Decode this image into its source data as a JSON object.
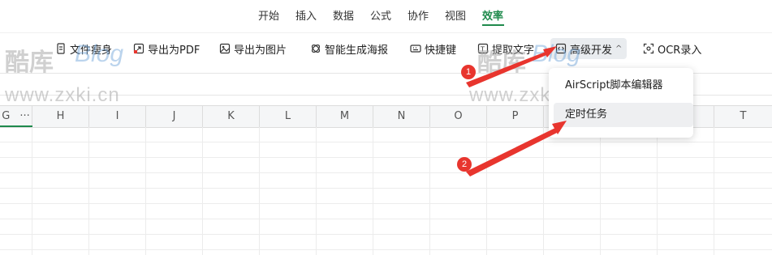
{
  "menu": {
    "items": [
      {
        "label": "开始"
      },
      {
        "label": "插入"
      },
      {
        "label": "数据"
      },
      {
        "label": "公式"
      },
      {
        "label": "协作"
      },
      {
        "label": "视图"
      },
      {
        "label": "效率",
        "active": true
      }
    ]
  },
  "toolbar": {
    "slim_file": "文件瘦身",
    "export_pdf": "导出为PDF",
    "export_image": "导出为图片",
    "smart_poster": "智能生成海报",
    "shortcuts": "快捷键",
    "extract_text": "提取文字",
    "advanced_dev": "高级开发",
    "advanced_dev_caret": "^",
    "ocr_input": "OCR录入"
  },
  "dropdown": {
    "items": [
      "AirScript脚本编辑器",
      "定时任务"
    ]
  },
  "columns": {
    "g": "G",
    "g_more": "···",
    "h": "H",
    "i": "I",
    "j": "J",
    "k": "K",
    "l": "L",
    "m": "M",
    "n": "N",
    "o": "O",
    "p": "P",
    "t": "T"
  },
  "watermark": {
    "cn": "酷库",
    "blog": "Blog",
    "url": "www.zxki.cn"
  },
  "annotations": {
    "badge1": "1",
    "badge2": "2",
    "arrow_color": "#e8352e"
  },
  "colors": {
    "accent": "#1f8a4c",
    "annotation": "#e8352e"
  }
}
